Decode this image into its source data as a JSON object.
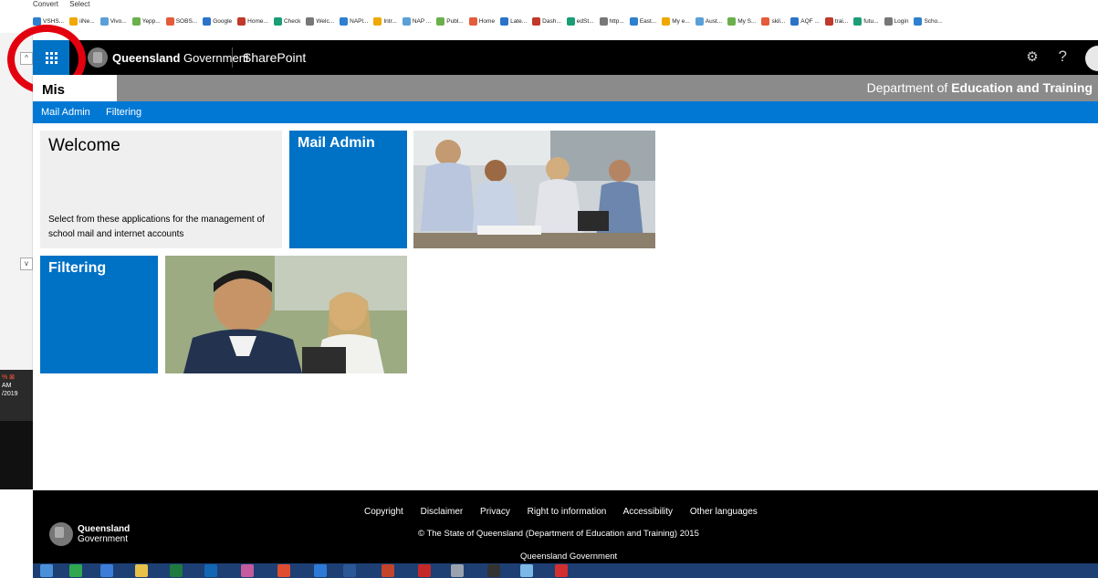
{
  "browser": {
    "commands": [
      "Convert",
      "Select"
    ],
    "favorites": [
      "VSHS...",
      "iiNe...",
      "Vivo...",
      "Yepp...",
      "SOBS...",
      "Google",
      "Home...",
      "Check",
      "Welc...",
      "NAPl...",
      "Intr...",
      "NAP ...",
      "Publ...",
      "Home",
      "Late...",
      "Dash...",
      "edSt...",
      "http...",
      "East...",
      "My e...",
      "Aust...",
      "My S...",
      "skil...",
      "AQF ...",
      "trai...",
      "futu...",
      "Login",
      "Scho..."
    ]
  },
  "suite": {
    "brand_bold": "Queensland",
    "brand_light": " Government",
    "app": "SharePoint",
    "help": "?"
  },
  "site": {
    "title": "Mis Gateway",
    "dept_prefix": "Department of ",
    "dept_bold": "Education and Training"
  },
  "nav": [
    "Mail Admin",
    "Filtering"
  ],
  "welcome": {
    "title": "Welcome",
    "text": "Select from these applications for the management of school mail and internet accounts"
  },
  "tiles": {
    "mail_admin": "Mail Admin",
    "filtering": "Filtering"
  },
  "footer": {
    "links": [
      "Copyright",
      "Disclaimer",
      "Privacy",
      "Right to information",
      "Accessibility",
      "Other languages"
    ],
    "copyright": "© The State of Queensland (Department of Education and Training) 2015",
    "org": "Queensland Government",
    "logo_line1": "Queensland",
    "logo_line2": "Government"
  },
  "side_clock": {
    "line1": "AM",
    "line2": "/2019"
  },
  "colors": {
    "accent": "#0072c6",
    "nav": "#0078d4",
    "suitebar": "#000000",
    "siteband": "#8b8b8b",
    "highlight_ring": "#e3000f"
  }
}
